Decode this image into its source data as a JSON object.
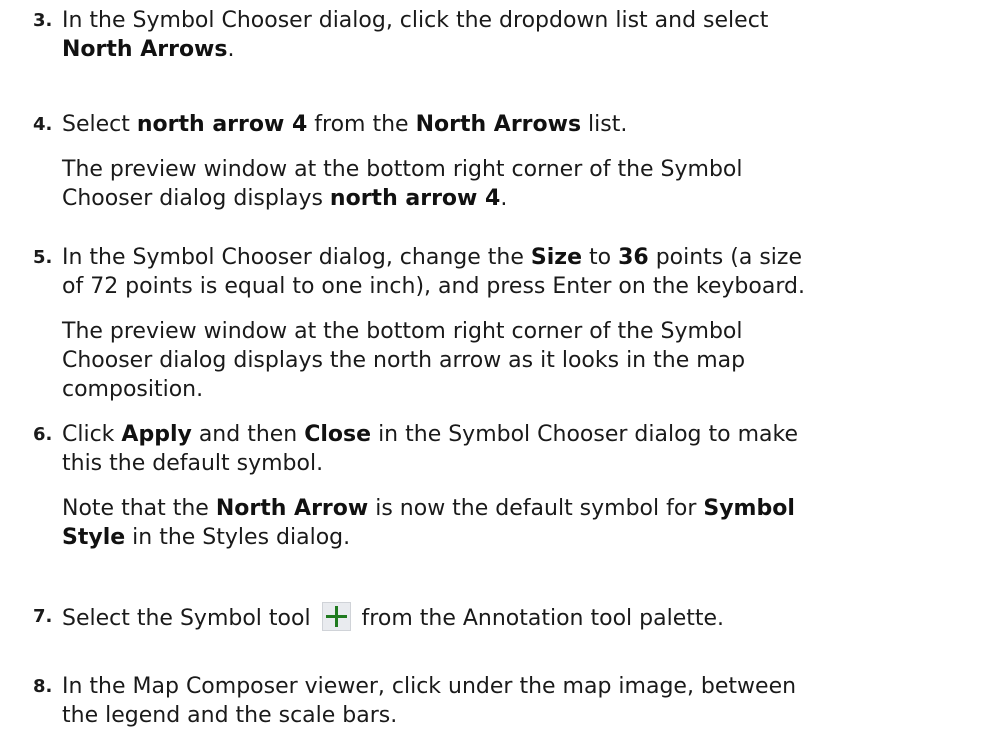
{
  "steps": [
    {
      "number": "3.",
      "line1_a": "In the Symbol Chooser dialog, click the dropdown list and select",
      "line2_bold": "North Arrows",
      "line2_tail": "."
    },
    {
      "number": "4.",
      "pre": "Select ",
      "bold1": "north arrow 4",
      "mid": " from the ",
      "bold2": "North Arrows",
      "post": " list.",
      "note_line1": "The preview window at the bottom right corner of the Symbol",
      "note_line2_pre": "Chooser dialog displays ",
      "note_line2_bold": "north arrow 4",
      "note_line2_post": "."
    },
    {
      "number": "5.",
      "line1_pre": "In the Symbol Chooser dialog, change the ",
      "bold_size": "Size",
      "line1_mid": " to ",
      "bold_36": "36",
      "line1_post": " points (a size",
      "line2": "of 72 points is equal to one inch), and press Enter on the keyboard.",
      "note_line1": "The preview window at the bottom right corner of the Symbol",
      "note_line2": "Chooser dialog displays the north arrow as it looks in the map",
      "note_line3": "composition."
    },
    {
      "number": "6.",
      "line1_pre": "Click ",
      "bold_apply": "Apply",
      "line1_mid": " and then ",
      "bold_close": "Close",
      "line1_post": " in the Symbol Chooser dialog to make",
      "line2": "this the default symbol.",
      "note_pre": "Note that the ",
      "note_bold1": "North Arrow",
      "note_mid": " is now the default symbol for ",
      "note_bold2": "Symbol",
      "note_bold3": "Style",
      "note_post": " in the Styles dialog."
    },
    {
      "number": "7.",
      "pre": "Select the Symbol tool ",
      "icon": "symbol-tool-crosshair-icon",
      "post": " from the Annotation tool palette."
    },
    {
      "number": "8.",
      "line1": "In the Map Composer viewer, click under the map image, between",
      "line2": "the legend and the scale bars."
    }
  ],
  "colors": {
    "text": "#1a1a1a",
    "icon_cross": "#1f7a1f",
    "icon_bg": "#e9ebef"
  }
}
